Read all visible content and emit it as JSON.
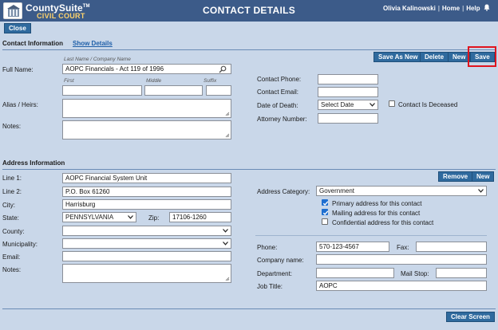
{
  "header": {
    "brand": "CountySuite",
    "brand_tm": "TM",
    "brand_sub": "CIVIL COURT",
    "title": "CONTACT DETAILS",
    "user": "Olivia Kalinowski",
    "home": "Home",
    "help": "Help"
  },
  "toolbar": {
    "close": "Close"
  },
  "contact": {
    "section_title": "Contact Information",
    "show_details": "Show Details",
    "buttons": {
      "save_as_new": "Save As New",
      "delete": "Delete",
      "new": "New",
      "save": "Save"
    },
    "full_name_label": "Full Name:",
    "hint_last": "Last Name / Company Name",
    "last_name": "AOPC Financials - Act 119 of 1996",
    "hint_first": "First",
    "hint_middle": "Middle",
    "hint_suffix": "Suffix",
    "first": "",
    "middle": "",
    "suffix": "",
    "alias_label": "Alias / Heirs:",
    "notes_label": "Notes:",
    "phone_label": "Contact Phone:",
    "phone": "",
    "email_label": "Contact Email:",
    "email": "",
    "dod_label": "Date of Death:",
    "dod_value": "Select Date",
    "deceased_label": "Contact Is Deceased",
    "attorney_label": "Attorney Number:",
    "attorney": ""
  },
  "address": {
    "section_title": "Address Information",
    "buttons": {
      "remove": "Remove",
      "new": "New"
    },
    "line1_label": "Line 1:",
    "line1": "AOPC Financial System Unit",
    "line2_label": "Line 2:",
    "line2": "P.O. Box 61260",
    "city_label": "City:",
    "city": "Harrisburg",
    "state_label": "State:",
    "state": "PENNSYLVANIA",
    "zip_label": "Zip:",
    "zip": "17106-1260",
    "county_label": "County:",
    "county": "",
    "municipality_label": "Municipality:",
    "municipality": "",
    "email_label": "Email:",
    "email": "",
    "notes_label": "Notes:",
    "category_label": "Address Category:",
    "category": "Government",
    "primary_label": "Primary address for this contact",
    "primary_checked": true,
    "mailing_label": "Mailing address for this contact",
    "mailing_checked": true,
    "confidential_label": "Confidential address for this contact",
    "confidential_checked": false,
    "phone_label": "Phone:",
    "phone": "570-123-4567",
    "fax_label": "Fax:",
    "fax": "",
    "company_label": "Company name:",
    "company": "",
    "department_label": "Department:",
    "department": "",
    "mailstop_label": "Mail Stop:",
    "mailstop": "",
    "jobtitle_label": "Job Title:",
    "jobtitle": "AOPC"
  },
  "footer": {
    "clear_screen": "Clear Screen"
  },
  "colors": {
    "header_bg": "#3c5b89",
    "page_bg": "#c9d7e9",
    "button_bg": "#2f6a9e",
    "brand_sub": "#ffd36b",
    "highlight": "#e0141e",
    "link": "#1f5fa8"
  },
  "icons": [
    "logo-icon",
    "bell-icon",
    "search-icon",
    "chevron-down-icon",
    "resize-grip-icon",
    "check-icon"
  ]
}
